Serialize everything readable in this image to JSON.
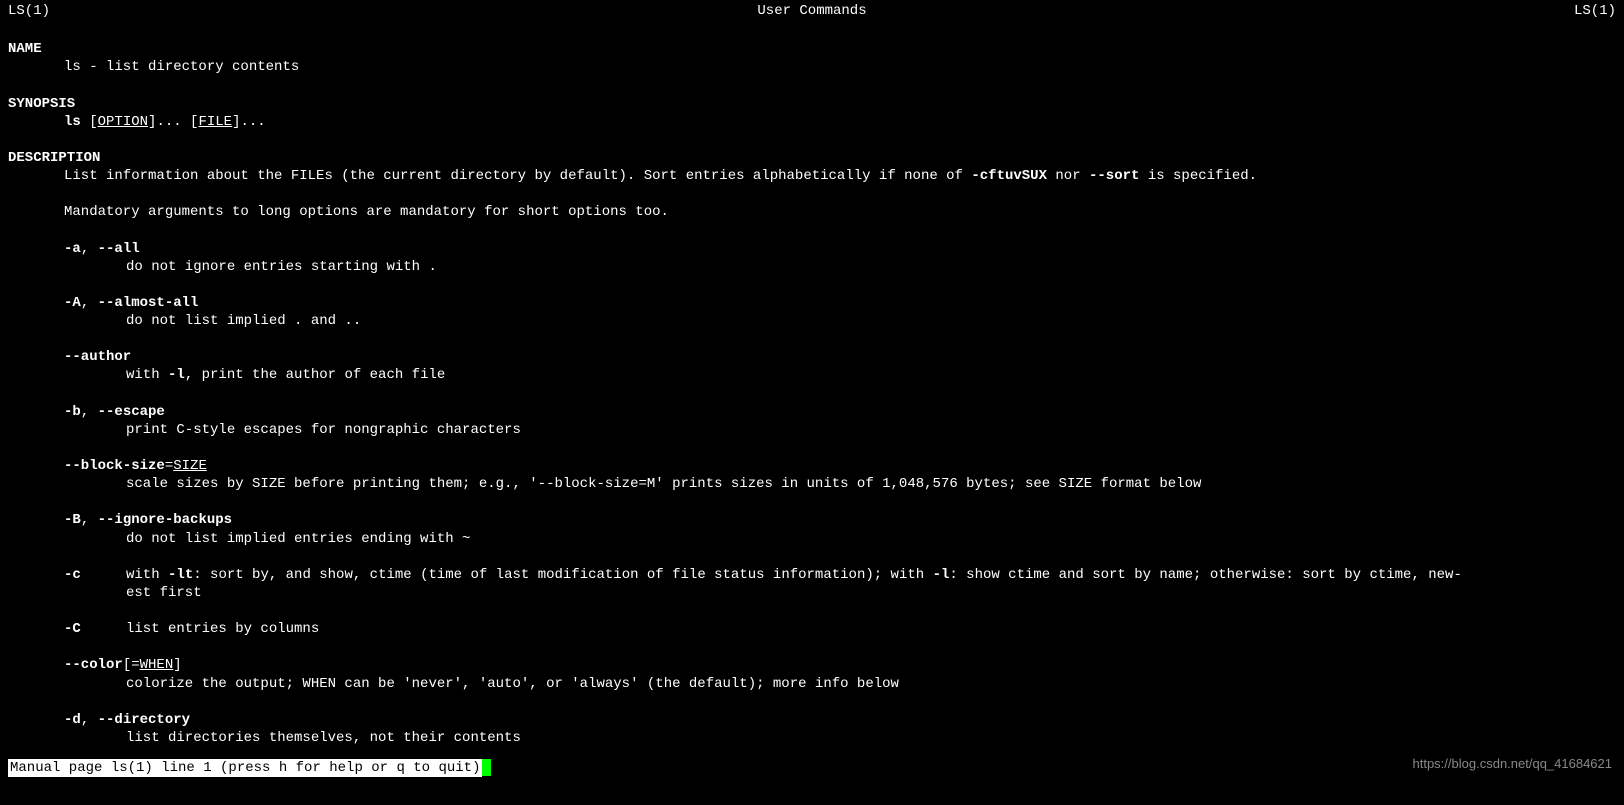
{
  "header": {
    "left": "LS(1)",
    "center": "User Commands",
    "right": "LS(1)"
  },
  "sections": {
    "name": {
      "title": "NAME",
      "body": "ls - list directory contents"
    },
    "synopsis": {
      "title": "SYNOPSIS",
      "cmd": "ls",
      "opt_label": "OPTION",
      "file_label": "FILE",
      "brackets": " [",
      "close1": "]... [",
      "close2": "]..."
    },
    "description": {
      "title": "DESCRIPTION",
      "line1_a": "List information about the FILEs (the current directory by default).  Sort entries alphabetically if none of ",
      "line1_b": "-cftuvSUX",
      "line1_c": " nor ",
      "line1_d": "--sort",
      "line1_e": " is specified.",
      "line2": "Mandatory arguments to long options are mandatory for short options too."
    },
    "options": [
      {
        "flags": "-a",
        "sep": ", ",
        "long": "--all",
        "desc": "do not ignore entries starting with ."
      },
      {
        "flags": "-A",
        "sep": ", ",
        "long": "--almost-all",
        "desc": "do not list implied . and .."
      },
      {
        "flags": "",
        "sep": "",
        "long": "--author",
        "desc_pre": "with ",
        "desc_bold": "-l",
        "desc_post": ", print the author of each file"
      },
      {
        "flags": "-b",
        "sep": ", ",
        "long": "--escape",
        "desc": "print C-style escapes for nongraphic characters"
      },
      {
        "flags": "",
        "sep": "",
        "long": "--block-size",
        "eq": "=",
        "arg": "SIZE",
        "desc": "scale sizes by SIZE before printing them; e.g., '--block-size=M' prints sizes in units of 1,048,576 bytes; see SIZE format below"
      },
      {
        "flags": "-B",
        "sep": ", ",
        "long": "--ignore-backups",
        "desc": "do not list implied entries ending with ~"
      }
    ],
    "opt_c": {
      "flag": "-c",
      "desc_a": "with  ",
      "desc_b1": "-lt",
      "desc_c": ": sort by, and show, ctime (time of last modification of file status information); with ",
      "desc_b2": "-l",
      "desc_d": ": show ctime and sort by name; otherwise: sort by ctime, new-",
      "desc_wrap": "est first"
    },
    "opt_C": {
      "flag": "-C",
      "desc": "list entries by columns"
    },
    "opt_color": {
      "long": "--color",
      "open": "[=",
      "arg": "WHEN",
      "close": "]",
      "desc": "colorize the output; WHEN can be 'never', 'auto', or 'always' (the default); more info below"
    },
    "opt_d": {
      "flags": "-d",
      "sep": ", ",
      "long": "--directory",
      "desc": "list directories themselves, not their contents"
    }
  },
  "status": "Manual page ls(1) line 1 (press h for help or q to quit)",
  "watermark": "https://blog.csdn.net/qq_41684621"
}
